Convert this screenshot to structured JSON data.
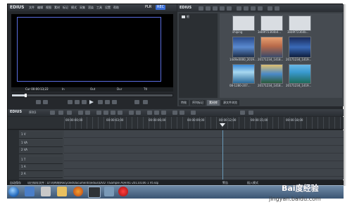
{
  "app": {
    "name": "EDIUS",
    "menu": [
      "文件",
      "编辑",
      "视图",
      "素材",
      "标记",
      "模式",
      "采集",
      "渲染",
      "工具",
      "设置",
      "帮助"
    ],
    "plr_label": "PLR",
    "rec_label": "REC"
  },
  "player": {
    "cur_label": "Cur 00:00:13;22",
    "in_label": "In",
    "out_label": "Out",
    "dur_label": "Dur",
    "ttl_label": "Ttl"
  },
  "bin": {
    "title": "EDIUS",
    "folder_root": "根",
    "thumbnails": [
      {
        "label": "shiping"
      },
      {
        "label": "3eb9f72364b4..."
      },
      {
        "label": "3eb9f72364b..."
      },
      {
        "label": "1449x0000_2019..."
      },
      {
        "label": "20171234_1418..."
      },
      {
        "label": "20171234_1419..."
      },
      {
        "label": "08-1280-207..."
      },
      {
        "label": "20171234_1418..."
      },
      {
        "label": "20171234_1419..."
      }
    ],
    "tabs": [
      "特效",
      "序列标记",
      "素材库",
      "源文件浏览"
    ]
  },
  "timeline": {
    "title": "EDIUS",
    "sequence": "序列1",
    "ruler": [
      "00:00:00;00",
      "00:00:03;00",
      "00:00:06;00",
      "00:00:09;00",
      "00:00:12;00",
      "00:00:15;00",
      "00:00:18;00"
    ],
    "tracks": [
      {
        "name": "1 V"
      },
      {
        "name": "1 VA"
      },
      {
        "name": "2 VA"
      },
      {
        "name": "1 T"
      },
      {
        "name": "1 A"
      },
      {
        "name": "2 A"
      }
    ]
  },
  "status": {
    "left": "自动保存",
    "path": "项目保存文件 : D:\\乌鸡啊\\Recycled\\documents\\edius\\DVD 7\\Sample A\\序列1-20110106 1 Vt.ezp",
    "mid": "警告",
    "right": "插入模式"
  },
  "watermark": {
    "line1": "Bai度经验",
    "line2": "jingyan.baidu.com"
  }
}
